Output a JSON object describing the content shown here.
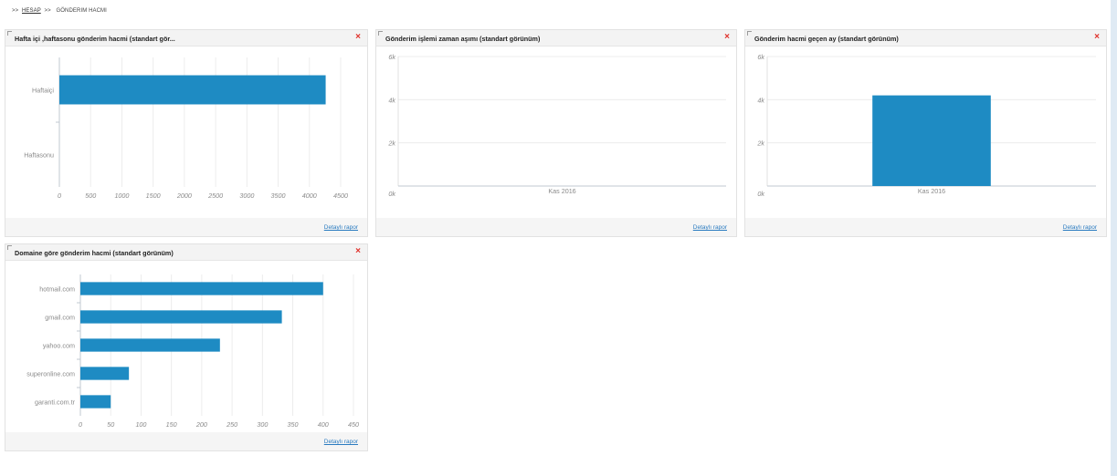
{
  "breadcrumb": {
    "sep": ">>",
    "parent": "HESAP",
    "current": "GÖNDERIM HACMI"
  },
  "colors": {
    "bar": "#1e8bc3",
    "close": "#e0312b",
    "link": "#2a7bc0"
  },
  "icons": {
    "close": "×"
  },
  "widgets": [
    {
      "title": "Hafta içi ,haftasonu gönderim hacmi (standart gör...",
      "link": "Detaylı rapor",
      "chart_data": {
        "type": "bar",
        "orientation": "horizontal",
        "categories": [
          "Haftaiçi",
          "Haftasonu"
        ],
        "values": [
          4260,
          0
        ],
        "xlim": [
          0,
          4500
        ],
        "xticks": [
          "0",
          "500",
          "1000",
          "1500",
          "2000",
          "2500",
          "3000",
          "3500",
          "4000",
          "4500"
        ],
        "grid": true
      }
    },
    {
      "title": "Gönderim işlemi zaman aşımı (standart görünüm)",
      "link": "Detaylı rapor",
      "chart_data": {
        "type": "bar",
        "orientation": "vertical",
        "categories": [
          "Kas 2016"
        ],
        "values": [
          0
        ],
        "ylim": [
          0,
          6000
        ],
        "yticks": [
          "0k",
          "2k",
          "4k",
          "6k"
        ],
        "grid": true
      }
    },
    {
      "title": "Gönderim hacmi geçen ay (standart görünüm)",
      "link": "Detaylı rapor",
      "chart_data": {
        "type": "bar",
        "orientation": "vertical",
        "categories": [
          "Kas 2016"
        ],
        "values": [
          4200
        ],
        "ylim": [
          0,
          6000
        ],
        "yticks": [
          "0k",
          "2k",
          "4k",
          "6k"
        ],
        "grid": true
      }
    },
    {
      "title": "Domaine göre gönderim hacmi (standart görünüm)",
      "link": "Detaylı rapor",
      "chart_data": {
        "type": "bar",
        "orientation": "horizontal",
        "categories": [
          "hotmail.com",
          "gmail.com",
          "yahoo.com",
          "superonline.com",
          "garanti.com.tr"
        ],
        "values": [
          400,
          332,
          230,
          80,
          50
        ],
        "xlim": [
          0,
          450
        ],
        "xticks": [
          "0",
          "50",
          "100",
          "150",
          "200",
          "250",
          "300",
          "350",
          "400",
          "450"
        ],
        "grid": true
      }
    }
  ]
}
